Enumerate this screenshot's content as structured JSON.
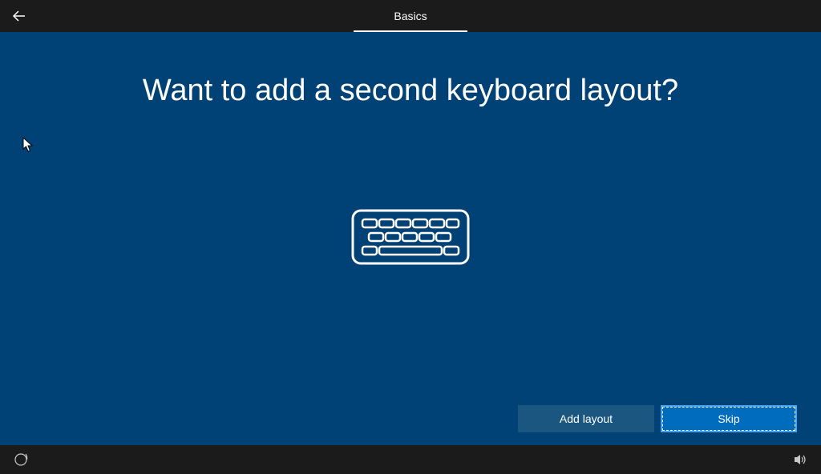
{
  "topbar": {
    "tabs": [
      {
        "label": "Basics",
        "active": true
      }
    ]
  },
  "main": {
    "heading": "Want to add a second keyboard layout?"
  },
  "buttons": {
    "add_layout_label": "Add layout",
    "skip_label": "Skip"
  }
}
